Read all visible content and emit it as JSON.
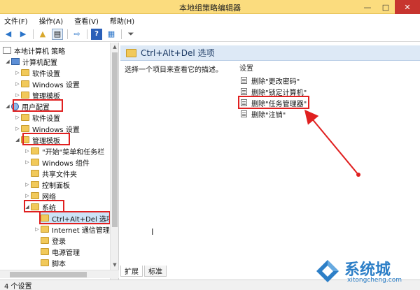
{
  "window": {
    "title": "本地组策略编辑器",
    "minimize": "—",
    "maximize": "□",
    "close": "✕"
  },
  "menu": {
    "file": "文件(F)",
    "action": "操作(A)",
    "view": "查看(V)",
    "help": "帮助(H)"
  },
  "toolbar": {
    "back": "◀",
    "forward": "▶",
    "up": "▲",
    "show_tree": "▤",
    "export": "⇨",
    "help": "?",
    "props": "▦",
    "filter": "⏷"
  },
  "tree": {
    "root": "本地计算机 策略",
    "computer_config": "计算机配置",
    "cc_software": "软件设置",
    "cc_windows": "Windows 设置",
    "cc_admin": "管理模板",
    "user_config": "用户配置",
    "uc_software": "软件设置",
    "uc_windows": "Windows 设置",
    "uc_admin": "管理模板",
    "start_menu": "\"开始\"菜单和任务栏",
    "win_components": "Windows 组件",
    "shared_folders": "共享文件夹",
    "control_panel": "控制面板",
    "network": "网络",
    "system": "系统",
    "cad": "Ctrl+Alt+Del 选项",
    "internet": "Internet 通信管理",
    "logon": "登录",
    "power": "电源管理",
    "scripts": "脚本"
  },
  "right": {
    "section_title": "Ctrl+Alt+Del 选项",
    "description": "选择一个项目来查看它的描述。",
    "column_header": "设置",
    "settings": [
      "删除\"更改密码\"",
      "删除\"锁定计算机\"",
      "删除\"任务管理器\"",
      "删除\"注销\""
    ],
    "tab_extended": "扩展",
    "tab_standard": "标准",
    "cursor": "I"
  },
  "status": {
    "text": "4 个设置"
  },
  "watermark": {
    "name": "系统城",
    "url": "xitongcheng.com"
  },
  "colors": {
    "titlebar": "#fbdc7e",
    "highlight_box": "#e02020",
    "section_header": "#dde9f6",
    "watermark": "#2d7fc7"
  }
}
